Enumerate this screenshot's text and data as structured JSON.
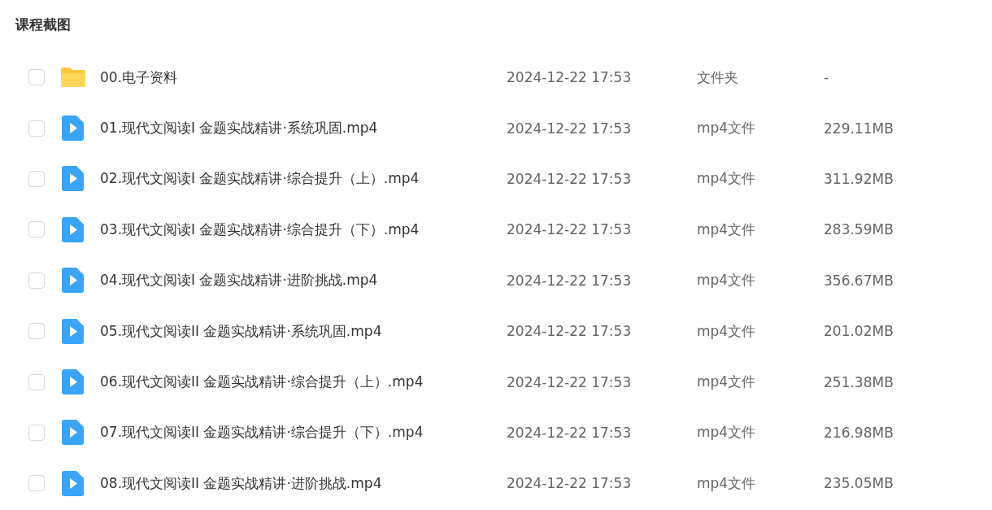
{
  "title": "课程截图",
  "files": [
    {
      "kind": "folder",
      "checked": false,
      "name": "00.电子资料",
      "modified": "2024-12-22 17:53",
      "type": "文件夹",
      "size": "-"
    },
    {
      "kind": "video",
      "checked": false,
      "name": "01.现代文阅读I 金题实战精讲·系统巩固.mp4",
      "modified": "2024-12-22 17:53",
      "type": "mp4文件",
      "size": "229.11MB"
    },
    {
      "kind": "video",
      "checked": false,
      "name": "02.现代文阅读I 金题实战精讲·综合提升（上）.mp4",
      "modified": "2024-12-22 17:53",
      "type": "mp4文件",
      "size": "311.92MB"
    },
    {
      "kind": "video",
      "checked": false,
      "name": "03.现代文阅读I 金题实战精讲·综合提升（下）.mp4",
      "modified": "2024-12-22 17:53",
      "type": "mp4文件",
      "size": "283.59MB"
    },
    {
      "kind": "video",
      "checked": false,
      "name": "04.现代文阅读I 金题实战精讲·进阶挑战.mp4",
      "modified": "2024-12-22 17:53",
      "type": "mp4文件",
      "size": "356.67MB"
    },
    {
      "kind": "video",
      "checked": false,
      "name": "05.现代文阅读II 金题实战精讲·系统巩固.mp4",
      "modified": "2024-12-22 17:53",
      "type": "mp4文件",
      "size": "201.02MB"
    },
    {
      "kind": "video",
      "checked": false,
      "name": "06.现代文阅读II 金题实战精讲·综合提升（上）.mp4",
      "modified": "2024-12-22 17:53",
      "type": "mp4文件",
      "size": "251.38MB"
    },
    {
      "kind": "video",
      "checked": false,
      "name": "07.现代文阅读II 金题实战精讲·综合提升（下）.mp4",
      "modified": "2024-12-22 17:53",
      "type": "mp4文件",
      "size": "216.98MB"
    },
    {
      "kind": "video",
      "checked": false,
      "name": "08.现代文阅读II 金题实战精讲·进阶挑战.mp4",
      "modified": "2024-12-22 17:53",
      "type": "mp4文件",
      "size": "235.05MB"
    }
  ]
}
